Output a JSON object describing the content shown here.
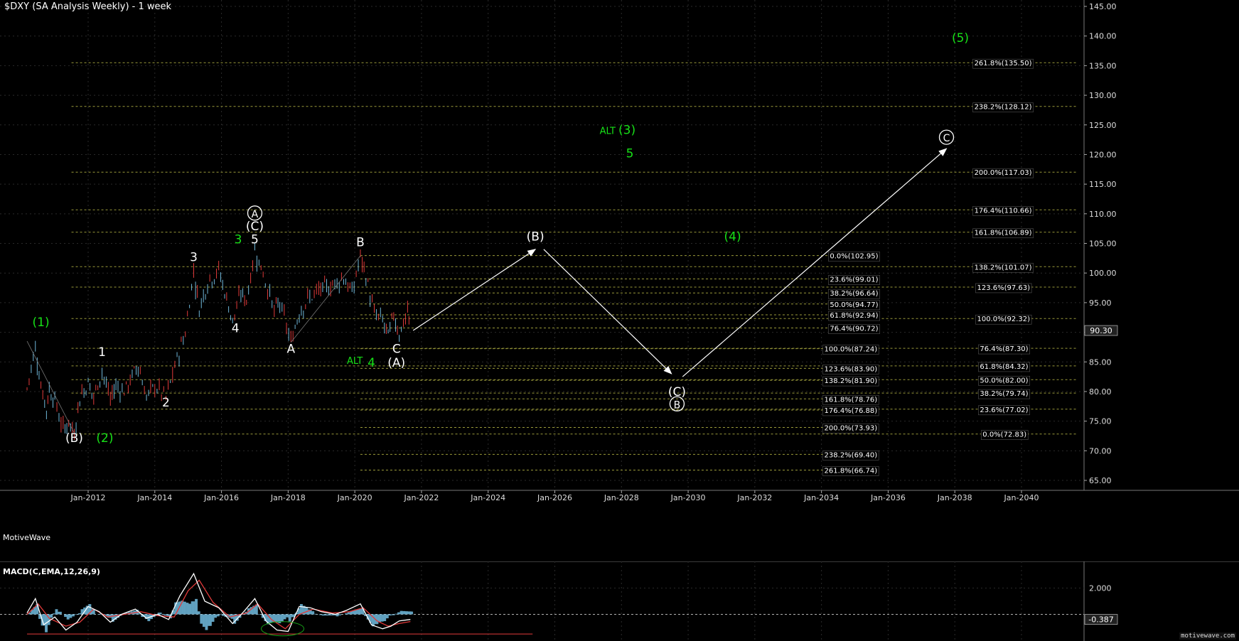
{
  "title": "$DXY (SA Analysis Weekly) - 1 week",
  "brand": "MotiveWave",
  "watermark": "motivewave.com",
  "macd_title": "MACD(C,EMA,12,26,9)",
  "colors": {
    "background": "#000000",
    "grid": "#2a2a2a",
    "fib_line": "#9a9a3a",
    "white_wave": "#ffffff",
    "green_wave": "#17e017",
    "bull_candle": "#6fb7d9",
    "bear_candle": "#e23a3a",
    "macd_line": "#ffffff",
    "signal_line": "#e23a3a",
    "histogram": "#6fb7d9"
  },
  "chart_data": [
    {
      "type": "line",
      "title": "$DXY (SA Analysis Weekly) - 1 week",
      "xlabel": "",
      "ylabel": "",
      "ylim": [
        62.5,
        146
      ],
      "xlim": [
        "2010-03",
        "2041-09"
      ],
      "grid": true,
      "x_ticks": [
        "Jan-2012",
        "Jan-2014",
        "Jan-2016",
        "Jan-2018",
        "Jan-2020",
        "Jan-2022",
        "Jan-2024",
        "Jan-2026",
        "Jan-2028",
        "Jan-2030",
        "Jan-2032",
        "Jan-2034",
        "Jan-2036",
        "Jan-2038",
        "Jan-2040"
      ],
      "y_ticks": [
        "65.00",
        "70.00",
        "75.00",
        "80.00",
        "85.00",
        "90.00",
        "95.00",
        "100.00",
        "105.00",
        "110.00",
        "115.00",
        "120.00",
        "125.00",
        "130.00",
        "135.00",
        "140.00",
        "145.00"
      ],
      "last_price": "90.30",
      "price_path": [
        {
          "x": "2010-03",
          "y": 80.5
        },
        {
          "x": "2010-06",
          "y": 87.5
        },
        {
          "x": "2010-08",
          "y": 81.0
        },
        {
          "x": "2010-10",
          "y": 77.0
        },
        {
          "x": "2010-11",
          "y": 80.5
        },
        {
          "x": "2011-01",
          "y": 78.5
        },
        {
          "x": "2011-04",
          "y": 73.5
        },
        {
          "x": "2011-06",
          "y": 75.0
        },
        {
          "x": "2011-08",
          "y": 73.0
        },
        {
          "x": "2011-10",
          "y": 79.0
        },
        {
          "x": "2012-01",
          "y": 81.5
        },
        {
          "x": "2012-03",
          "y": 79.0
        },
        {
          "x": "2012-06",
          "y": 83.5
        },
        {
          "x": "2012-09",
          "y": 78.7
        },
        {
          "x": "2012-11",
          "y": 81.0
        },
        {
          "x": "2013-02",
          "y": 80.0
        },
        {
          "x": "2013-07",
          "y": 84.5
        },
        {
          "x": "2013-10",
          "y": 79.0
        },
        {
          "x": "2014-01",
          "y": 81.0
        },
        {
          "x": "2014-05",
          "y": 78.9
        },
        {
          "x": "2014-09",
          "y": 85.5
        },
        {
          "x": "2014-12",
          "y": 90.0
        },
        {
          "x": "2015-03",
          "y": 100.4
        },
        {
          "x": "2015-05",
          "y": 94.0
        },
        {
          "x": "2015-08",
          "y": 98.5
        },
        {
          "x": "2015-12",
          "y": 100.5
        },
        {
          "x": "2016-05",
          "y": 91.9
        },
        {
          "x": "2016-08",
          "y": 96.5
        },
        {
          "x": "2016-10",
          "y": 95.5
        },
        {
          "x": "2017-01",
          "y": 103.8
        },
        {
          "x": "2017-04",
          "y": 100.0
        },
        {
          "x": "2017-08",
          "y": 93.5
        },
        {
          "x": "2017-10",
          "y": 95.0
        },
        {
          "x": "2018-02",
          "y": 88.3
        },
        {
          "x": "2018-05",
          "y": 93.5
        },
        {
          "x": "2018-08",
          "y": 95.5
        },
        {
          "x": "2018-12",
          "y": 97.0
        },
        {
          "x": "2019-05",
          "y": 98.0
        },
        {
          "x": "2019-09",
          "y": 99.3
        },
        {
          "x": "2019-12",
          "y": 96.5
        },
        {
          "x": "2020-03",
          "y": 102.9
        },
        {
          "x": "2020-05",
          "y": 99.5
        },
        {
          "x": "2020-08",
          "y": 93.0
        },
        {
          "x": "2020-11",
          "y": 92.0
        },
        {
          "x": "2021-01",
          "y": 89.3
        },
        {
          "x": "2021-03",
          "y": 93.0
        },
        {
          "x": "2021-05",
          "y": 89.7
        },
        {
          "x": "2021-08",
          "y": 93.5
        },
        {
          "x": "2021-09",
          "y": 90.3
        }
      ],
      "projection_arrows": [
        [
          {
            "x": "2021-10",
            "y": 90.3
          },
          {
            "x": "2025-06",
            "y": 104.0
          }
        ],
        [
          {
            "x": "2025-09",
            "y": 104.0
          },
          {
            "x": "2029-07",
            "y": 83.0
          }
        ],
        [
          {
            "x": "2029-11",
            "y": 82.5
          },
          {
            "x": "2037-10",
            "y": 121.0
          }
        ]
      ],
      "wave_labels": [
        {
          "text": "(1)",
          "x": "2010-08",
          "y": 91.0,
          "color": "green"
        },
        {
          "text": "(2)",
          "x": "2012-07",
          "y": 71.5,
          "color": "green"
        },
        {
          "text": "(B)",
          "x": "2011-08",
          "y": 71.5,
          "color": "white"
        },
        {
          "text": "1",
          "x": "2012-06",
          "y": 86.0,
          "color": "white"
        },
        {
          "text": "2",
          "x": "2014-05",
          "y": 77.5,
          "color": "white"
        },
        {
          "text": "3",
          "x": "2015-03",
          "y": 102.0,
          "color": "white"
        },
        {
          "text": "4",
          "x": "2016-06",
          "y": 90.0,
          "color": "white"
        },
        {
          "text": "3",
          "x": "2016-07",
          "y": 105.0,
          "color": "green"
        },
        {
          "text": "5",
          "x": "2017-01",
          "y": 105.0,
          "color": "white"
        },
        {
          "text": "(C)",
          "x": "2017-01",
          "y": 107.2,
          "color": "white"
        },
        {
          "text": "A",
          "x": "2017-01",
          "y": 109.4,
          "color": "white",
          "circled": true
        },
        {
          "text": "A",
          "x": "2018-02",
          "y": 86.5,
          "color": "white"
        },
        {
          "text": "B",
          "x": "2020-03",
          "y": 104.5,
          "color": "white"
        },
        {
          "text": "C",
          "x": "2021-04",
          "y": 86.5,
          "color": "white"
        },
        {
          "text": "(A)",
          "x": "2021-04",
          "y": 84.2,
          "color": "white"
        },
        {
          "text": "4",
          "x": "2020-07",
          "y": 84.2,
          "color": "green"
        },
        {
          "text": "ALT",
          "x": "2020-01",
          "y": 84.7,
          "color": "green",
          "small": true
        },
        {
          "text": "(B)",
          "x": "2025-06",
          "y": 105.5,
          "color": "white"
        },
        {
          "text": "ALT",
          "x": "2027-08",
          "y": 123.5,
          "color": "green",
          "small": true
        },
        {
          "text": "(3)",
          "x": "2028-03",
          "y": 123.5,
          "color": "green"
        },
        {
          "text": "5",
          "x": "2028-04",
          "y": 119.5,
          "color": "green"
        },
        {
          "text": "(4)",
          "x": "2031-05",
          "y": 105.5,
          "color": "green"
        },
        {
          "text": "(C)",
          "x": "2029-09",
          "y": 79.3,
          "color": "white"
        },
        {
          "text": "B",
          "x": "2029-09",
          "y": 77.2,
          "color": "white",
          "circled": true
        },
        {
          "text": "C",
          "x": "2037-10",
          "y": 122.2,
          "color": "white",
          "circled": true
        },
        {
          "text": "(5)",
          "x": "2038-03",
          "y": 139.0,
          "color": "green"
        }
      ],
      "fib_levels": [
        {
          "label": "261.8%(135.50)",
          "y": 135.5,
          "x_from": "2011-07",
          "x_to": "2041-09",
          "label_x": "2038-08"
        },
        {
          "label": "238.2%(128.12)",
          "y": 128.12,
          "x_from": "2011-07",
          "x_to": "2041-09",
          "label_x": "2038-08"
        },
        {
          "label": "200.0%(117.03)",
          "y": 117.03,
          "x_from": "2011-07",
          "x_to": "2041-09",
          "label_x": "2038-08"
        },
        {
          "label": "176.4%(110.66)",
          "y": 110.66,
          "x_from": "2011-07",
          "x_to": "2041-09",
          "label_x": "2038-08"
        },
        {
          "label": "161.8%(106.89)",
          "y": 106.89,
          "x_from": "2011-07",
          "x_to": "2041-09",
          "label_x": "2038-08"
        },
        {
          "label": "138.2%(101.07)",
          "y": 101.07,
          "x_from": "2011-07",
          "x_to": "2041-09",
          "label_x": "2038-08"
        },
        {
          "label": "123.6%(97.63)",
          "y": 97.63,
          "x_from": "2011-07",
          "x_to": "2041-09",
          "label_x": "2038-09"
        },
        {
          "label": "100.0%(92.32)",
          "y": 92.32,
          "x_from": "2011-07",
          "x_to": "2041-09",
          "label_x": "2038-09"
        },
        {
          "label": "76.4%(87.30)",
          "y": 87.3,
          "x_from": "2011-07",
          "x_to": "2041-09",
          "label_x": "2038-10"
        },
        {
          "label": "61.8%(84.32)",
          "y": 84.32,
          "x_from": "2011-07",
          "x_to": "2041-09",
          "label_x": "2038-10"
        },
        {
          "label": "50.0%(82.00)",
          "y": 82.0,
          "x_from": "2011-07",
          "x_to": "2041-09",
          "label_x": "2038-10"
        },
        {
          "label": "38.2%(79.74)",
          "y": 79.74,
          "x_from": "2011-07",
          "x_to": "2041-09",
          "label_x": "2038-10"
        },
        {
          "label": "23.6%(77.02)",
          "y": 77.02,
          "x_from": "2011-07",
          "x_to": "2041-09",
          "label_x": "2038-10"
        },
        {
          "label": "0.0%(72.83)",
          "y": 72.83,
          "x_from": "2011-07",
          "x_to": "2041-09",
          "label_x": "2038-11"
        },
        {
          "label": "0.0%(102.95)",
          "y": 102.95,
          "x_from": "2020-03",
          "x_to": "2034-12",
          "label_x": "2034-04"
        },
        {
          "label": "23.6%(99.01)",
          "y": 99.01,
          "x_from": "2020-03",
          "x_to": "2034-12",
          "label_x": "2034-04"
        },
        {
          "label": "38.2%(96.64)",
          "y": 96.64,
          "x_from": "2020-03",
          "x_to": "2034-12",
          "label_x": "2034-04"
        },
        {
          "label": "50.0%(94.77)",
          "y": 94.77,
          "x_from": "2020-03",
          "x_to": "2034-12",
          "label_x": "2034-04"
        },
        {
          "label": "61.8%(92.94)",
          "y": 92.94,
          "x_from": "2020-03",
          "x_to": "2034-12",
          "label_x": "2034-04"
        },
        {
          "label": "76.4%(90.72)",
          "y": 90.72,
          "x_from": "2020-03",
          "x_to": "2034-12",
          "label_x": "2034-04"
        },
        {
          "label": "100.0%(87.24)",
          "y": 87.24,
          "x_from": "2020-03",
          "x_to": "2034-12",
          "label_x": "2034-02"
        },
        {
          "label": "123.6%(83.90)",
          "y": 83.9,
          "x_from": "2020-03",
          "x_to": "2034-12",
          "label_x": "2034-02"
        },
        {
          "label": "138.2%(81.90)",
          "y": 81.9,
          "x_from": "2020-03",
          "x_to": "2034-12",
          "label_x": "2034-02"
        },
        {
          "label": "161.8%(78.76)",
          "y": 78.76,
          "x_from": "2020-03",
          "x_to": "2034-12",
          "label_x": "2034-02"
        },
        {
          "label": "176.4%(76.88)",
          "y": 76.88,
          "x_from": "2020-03",
          "x_to": "2034-12",
          "label_x": "2034-02"
        },
        {
          "label": "200.0%(73.93)",
          "y": 73.93,
          "x_from": "2020-03",
          "x_to": "2034-12",
          "label_x": "2034-02"
        },
        {
          "label": "238.2%(69.40)",
          "y": 69.4,
          "x_from": "2020-03",
          "x_to": "2034-12",
          "label_x": "2034-02"
        },
        {
          "label": "261.8%(66.74)",
          "y": 66.74,
          "x_from": "2020-03",
          "x_to": "2034-12",
          "label_x": "2034-02"
        }
      ]
    },
    {
      "type": "line",
      "title": "MACD(C,EMA,12,26,9)",
      "ylim": [
        -1.6,
        3.6
      ],
      "y_ticks": [
        "2.000"
      ],
      "last_value": "-0.387",
      "macd": [
        {
          "x": "2010-03",
          "y": 0.1
        },
        {
          "x": "2010-06",
          "y": 1.2
        },
        {
          "x": "2010-09",
          "y": -0.8
        },
        {
          "x": "2011-01",
          "y": -0.2
        },
        {
          "x": "2011-05",
          "y": -1.2
        },
        {
          "x": "2011-09",
          "y": -0.6
        },
        {
          "x": "2012-01",
          "y": 0.6
        },
        {
          "x": "2012-05",
          "y": 0.2
        },
        {
          "x": "2012-09",
          "y": -0.6
        },
        {
          "x": "2013-01",
          "y": 0.0
        },
        {
          "x": "2013-06",
          "y": 0.4
        },
        {
          "x": "2013-10",
          "y": -0.3
        },
        {
          "x": "2014-02",
          "y": 0.0
        },
        {
          "x": "2014-06",
          "y": -0.4
        },
        {
          "x": "2014-10",
          "y": 1.4
        },
        {
          "x": "2015-03",
          "y": 3.1
        },
        {
          "x": "2015-07",
          "y": 1.0
        },
        {
          "x": "2015-12",
          "y": 0.5
        },
        {
          "x": "2016-05",
          "y": -0.7
        },
        {
          "x": "2016-09",
          "y": 0.2
        },
        {
          "x": "2017-01",
          "y": 1.2
        },
        {
          "x": "2017-05",
          "y": -0.5
        },
        {
          "x": "2017-09",
          "y": -1.2
        },
        {
          "x": "2018-01",
          "y": -1.3
        },
        {
          "x": "2018-05",
          "y": 0.6
        },
        {
          "x": "2018-09",
          "y": 0.5
        },
        {
          "x": "2019-01",
          "y": 0.2
        },
        {
          "x": "2019-06",
          "y": 0.0
        },
        {
          "x": "2019-10",
          "y": 0.3
        },
        {
          "x": "2020-03",
          "y": 0.8
        },
        {
          "x": "2020-07",
          "y": -0.8
        },
        {
          "x": "2020-11",
          "y": -1.1
        },
        {
          "x": "2021-02",
          "y": -0.9
        },
        {
          "x": "2021-05",
          "y": -0.5
        },
        {
          "x": "2021-09",
          "y": -0.39
        }
      ],
      "signal": [
        {
          "x": "2010-03",
          "y": 0.0
        },
        {
          "x": "2010-07",
          "y": 0.8
        },
        {
          "x": "2010-11",
          "y": -0.3
        },
        {
          "x": "2011-05",
          "y": -0.9
        },
        {
          "x": "2011-10",
          "y": -0.6
        },
        {
          "x": "2012-03",
          "y": 0.4
        },
        {
          "x": "2012-08",
          "y": -0.2
        },
        {
          "x": "2013-02",
          "y": 0.0
        },
        {
          "x": "2013-08",
          "y": 0.2
        },
        {
          "x": "2014-02",
          "y": -0.1
        },
        {
          "x": "2014-08",
          "y": -0.2
        },
        {
          "x": "2015-01",
          "y": 1.8
        },
        {
          "x": "2015-05",
          "y": 2.6
        },
        {
          "x": "2015-10",
          "y": 0.9
        },
        {
          "x": "2016-04",
          "y": -0.2
        },
        {
          "x": "2016-10",
          "y": 0.1
        },
        {
          "x": "2017-02",
          "y": 0.8
        },
        {
          "x": "2017-07",
          "y": -0.4
        },
        {
          "x": "2017-12",
          "y": -1.1
        },
        {
          "x": "2018-05",
          "y": 0.0
        },
        {
          "x": "2018-10",
          "y": 0.4
        },
        {
          "x": "2019-05",
          "y": 0.1
        },
        {
          "x": "2019-11",
          "y": 0.2
        },
        {
          "x": "2020-04",
          "y": 0.5
        },
        {
          "x": "2020-09",
          "y": -0.5
        },
        {
          "x": "2021-01",
          "y": -0.9
        },
        {
          "x": "2021-05",
          "y": -0.7
        },
        {
          "x": "2021-09",
          "y": -0.55
        }
      ],
      "signal_guide": [
        {
          "x": "2010-03",
          "y": -1.5
        },
        {
          "x": "2025-05",
          "y": -1.5
        }
      ]
    }
  ]
}
